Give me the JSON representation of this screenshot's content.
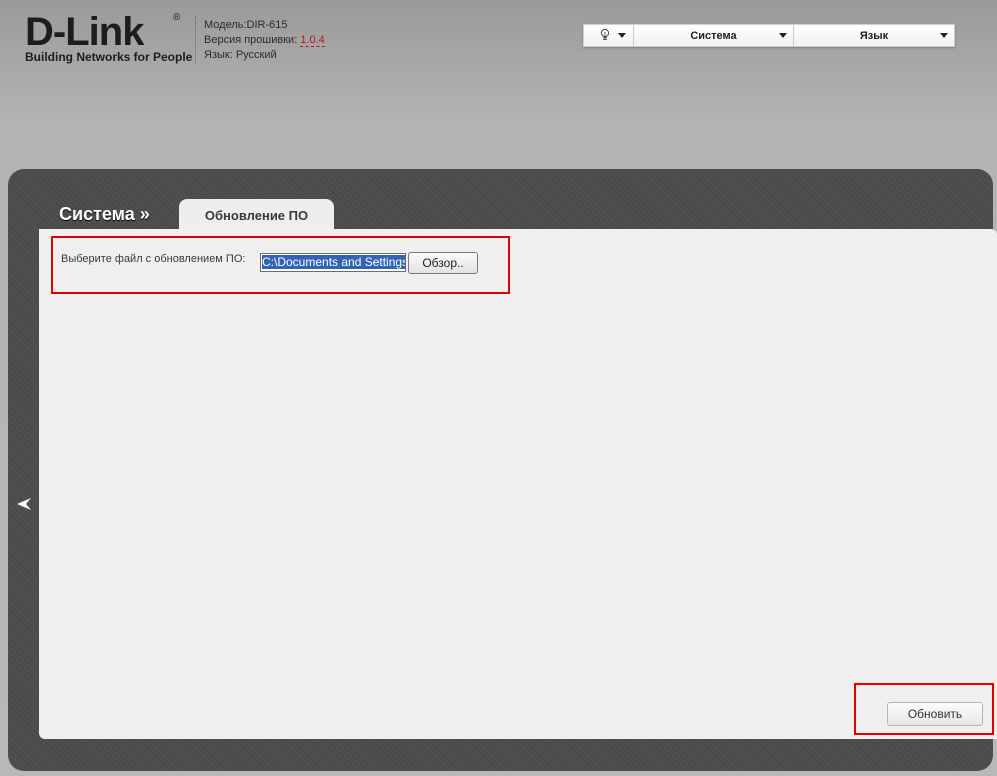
{
  "brand": {
    "name": "D-Link",
    "tagline": "Building Networks for People",
    "registered": "®"
  },
  "device": {
    "model_label": "Модель:",
    "model_value": "DIR-615",
    "firmware_label": "Версия прошивки:",
    "firmware_value": "1.0.4",
    "language_label": "Язык:",
    "language_value": "Русский"
  },
  "topbar": {
    "hint_icon": "lightbulb-icon",
    "system_label": "Система",
    "language_label": "Язык"
  },
  "page": {
    "breadcrumb": "Система »",
    "tab_label": "Обновление ПО"
  },
  "form": {
    "file_label": "Выберите файл с обновлением ПО:",
    "file_value": "C:\\Documents and Settings",
    "browse_label": "Обзор..",
    "update_label": "Обновить"
  },
  "colors": {
    "accent_red": "#e00000",
    "firmware_red": "#c4141b",
    "panel_dark": "#4a4a4a",
    "selection_blue": "#3263b4"
  }
}
